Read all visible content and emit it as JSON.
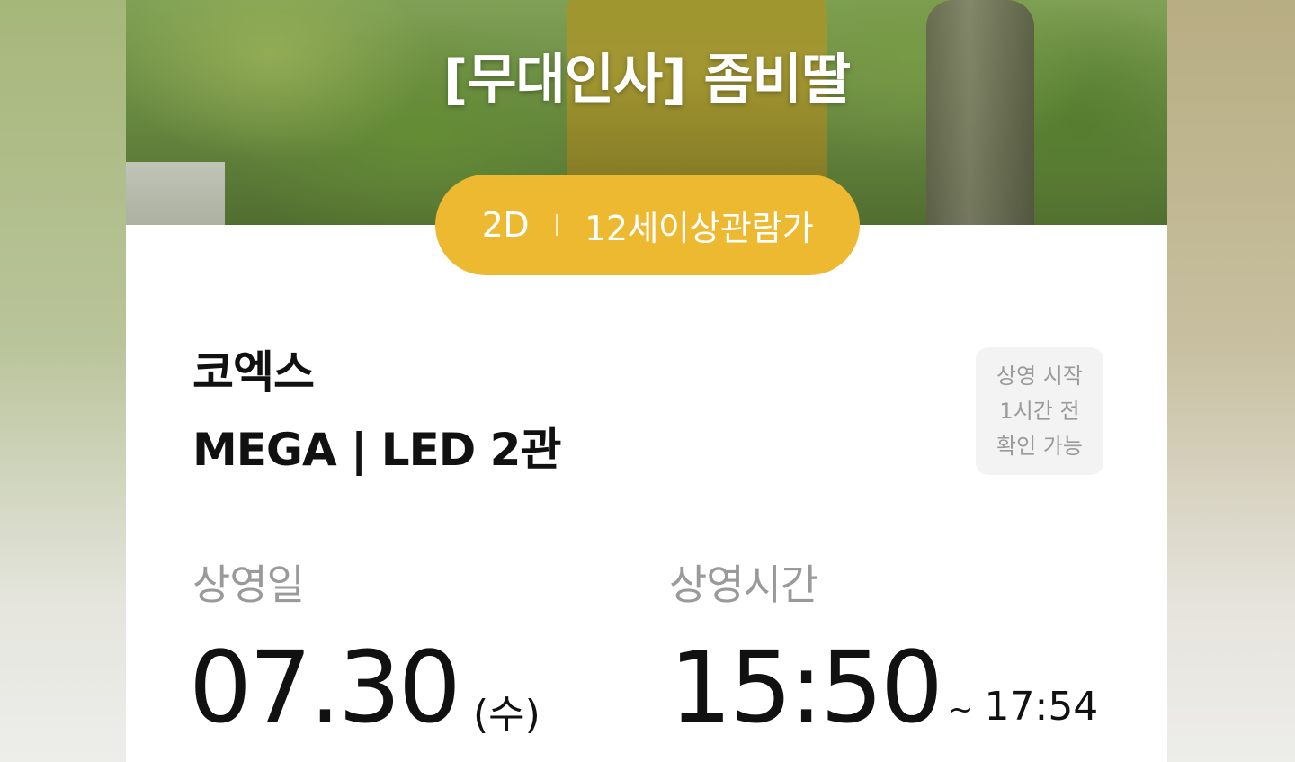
{
  "movie": {
    "title": "[무대인사] 좀비딸",
    "format": "2D",
    "rating": "12세이상관람가"
  },
  "theater": {
    "name": "코엑스",
    "screen": "MEGA | LED 2관"
  },
  "notice": {
    "text": "상영 시작\n1시간 전\n확인 가능"
  },
  "schedule": {
    "date_label": "상영일",
    "date": "07.30",
    "day": "(수)",
    "time_label": "상영시간",
    "start_time": "15:50",
    "tilde": "~",
    "end_time": "17:54"
  },
  "colors": {
    "accent": "#edb931",
    "text_primary": "#111111",
    "text_secondary": "#9a9a9a"
  }
}
